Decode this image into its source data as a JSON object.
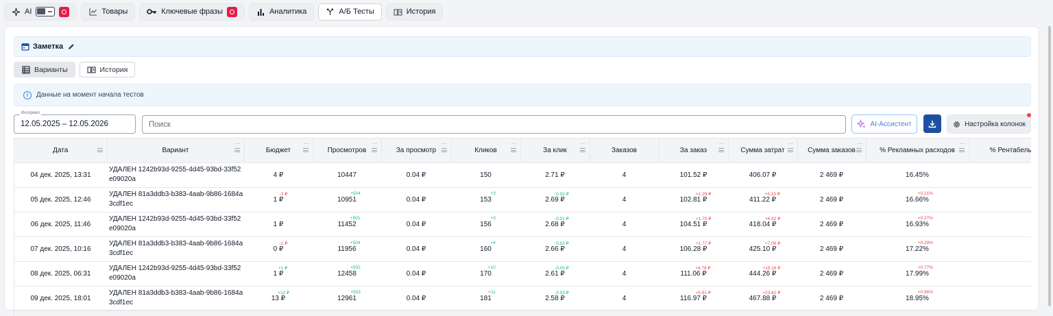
{
  "topbar": {
    "ai_label": "AI",
    "products_label": "Товары",
    "keywords_label": "Ключевые фразы",
    "analytics_label": "Аналитика",
    "abtests_label": "А/Б Тесты",
    "history_label": "История"
  },
  "note": {
    "title": "Заметка"
  },
  "subtabs": {
    "variants_label": "Варианты",
    "history_label": "История"
  },
  "info": {
    "text": "Данные на момент начала тестов"
  },
  "filters": {
    "interval_label": "Интервал",
    "interval_value": "12.05.2025 – 12.05.2026",
    "search_placeholder": "Поиск",
    "ai_button_label": "AI-Ассистент",
    "columns_button_label": "Настройка колонок"
  },
  "colors": {
    "accent": "#1e4fa3",
    "delta_up": "#10b981",
    "delta_down": "#ef4444",
    "badge": "#e11d48"
  },
  "table": {
    "headers": [
      "Дата",
      "Вариант",
      "Бюджет",
      "Просмотров",
      "За просмотр",
      "Кликов",
      "За клик",
      "Заказов",
      "За заказ",
      "Сумма затрат",
      "Сумма заказов",
      "% Рекламных расходов",
      "% Рентабельн"
    ],
    "rows": [
      {
        "date": "04 дек. 2025, 13:31",
        "variant": "УДАЛЕН 1242b93d-9255-4d45-93bd-33f52e09020a",
        "budget": "4 ₽",
        "budget_d": "",
        "budget_dc": "",
        "views": "10447",
        "views_d": "",
        "views_dc": "",
        "per_view": "0.04 ₽",
        "clicks": "150",
        "clicks_d": "",
        "clicks_dc": "",
        "per_click": "2.71 ₽",
        "per_click_d": "",
        "per_click_dc": "",
        "orders": "4",
        "per_order": "101.52 ₽",
        "per_order_d": "",
        "per_order_dc": "",
        "spend": "406.07 ₽",
        "spend_d": "",
        "spend_dc": "",
        "order_sum": "2 469 ₽",
        "ad_pct": "16.45%",
        "ad_pct_d": "",
        "ad_pct_dc": "",
        "profit": ""
      },
      {
        "date": "05 дек. 2025, 12:46",
        "variant": "УДАЛЕН 81a3ddb3-b383-4aab-9b86-1684a3cdf1ec",
        "budget": "1 ₽",
        "budget_d": "-3 ₽",
        "budget_dc": "down",
        "views": "10951",
        "views_d": "+504",
        "views_dc": "up",
        "per_view": "0.04 ₽",
        "clicks": "153",
        "clicks_d": "+3",
        "clicks_dc": "up",
        "per_click": "2.69 ₽",
        "per_click_d": "-0.02 ₽",
        "per_click_dc": "up",
        "orders": "4",
        "per_order": "102.81 ₽",
        "per_order_d": "+1.29 ₽",
        "per_order_dc": "down",
        "spend": "411.22 ₽",
        "spend_d": "+5.15 ₽",
        "spend_dc": "down",
        "order_sum": "2 469 ₽",
        "ad_pct": "16.66%",
        "ad_pct_d": "+0.21%",
        "ad_pct_dc": "down",
        "profit": ""
      },
      {
        "date": "06 дек. 2025, 11:46",
        "variant": "УДАЛЕН 1242b93d-9255-4d45-93bd-33f52e09020a",
        "budget": "1 ₽",
        "budget_d": "",
        "budget_dc": "",
        "views": "11452",
        "views_d": "+501",
        "views_dc": "up",
        "per_view": "0.04 ₽",
        "clicks": "156",
        "clicks_d": "+3",
        "clicks_dc": "up",
        "per_click": "2.68 ₽",
        "per_click_d": "-0.01 ₽",
        "per_click_dc": "up",
        "orders": "4",
        "per_order": "104.51 ₽",
        "per_order_d": "+1.70 ₽",
        "per_order_dc": "down",
        "spend": "418.04 ₽",
        "spend_d": "+6.82 ₽",
        "spend_dc": "down",
        "order_sum": "2 469 ₽",
        "ad_pct": "16.93%",
        "ad_pct_d": "+0.27%",
        "ad_pct_dc": "down",
        "profit": ""
      },
      {
        "date": "07 дек. 2025, 10:16",
        "variant": "УДАЛЕН 81a3ddb3-b383-4aab-9b86-1684a3cdf1ec",
        "budget": "0 ₽",
        "budget_d": "-1 ₽",
        "budget_dc": "down",
        "views": "11956",
        "views_d": "+504",
        "views_dc": "up",
        "per_view": "0.04 ₽",
        "clicks": "160",
        "clicks_d": "+4",
        "clicks_dc": "up",
        "per_click": "2.66 ₽",
        "per_click_d": "-0.02 ₽",
        "per_click_dc": "up",
        "orders": "4",
        "per_order": "106.28 ₽",
        "per_order_d": "+1.77 ₽",
        "per_order_dc": "down",
        "spend": "425.10 ₽",
        "spend_d": "+7.06 ₽",
        "spend_dc": "down",
        "order_sum": "2 469 ₽",
        "ad_pct": "17.22%",
        "ad_pct_d": "+0.29%",
        "ad_pct_dc": "down",
        "profit": ""
      },
      {
        "date": "08 дек. 2025, 06:31",
        "variant": "УДАЛЕН 1242b93d-9255-4d45-93bd-33f52e09020a",
        "budget": "1 ₽",
        "budget_d": "+1 ₽",
        "budget_dc": "up",
        "views": "12458",
        "views_d": "+502",
        "views_dc": "up",
        "per_view": "0.04 ₽",
        "clicks": "170",
        "clicks_d": "+10",
        "clicks_dc": "up",
        "per_click": "2.61 ₽",
        "per_click_d": "-0.05 ₽",
        "per_click_dc": "up",
        "orders": "4",
        "per_order": "111.06 ₽",
        "per_order_d": "+4.78 ₽",
        "per_order_dc": "down",
        "spend": "444.26 ₽",
        "spend_d": "+19.16 ₽",
        "spend_dc": "down",
        "order_sum": "2 469 ₽",
        "ad_pct": "17.99%",
        "ad_pct_d": "+0.77%",
        "ad_pct_dc": "down",
        "profit": ""
      },
      {
        "date": "09 дек. 2025, 18:01",
        "variant": "УДАЛЕН 81a3ddb3-b383-4aab-9b86-1684a3cdf1ec",
        "budget": "13 ₽",
        "budget_d": "+12 ₽",
        "budget_dc": "up",
        "views": "12961",
        "views_d": "+503",
        "views_dc": "up",
        "per_view": "0.04 ₽",
        "clicks": "181",
        "clicks_d": "+11",
        "clicks_dc": "up",
        "per_click": "2.58 ₽",
        "per_click_d": "-0.03 ₽",
        "per_click_dc": "up",
        "orders": "4",
        "per_order": "116.97 ₽",
        "per_order_d": "+5.91 ₽",
        "per_order_dc": "down",
        "spend": "467.88 ₽",
        "spend_d": "+23.62 ₽",
        "spend_dc": "down",
        "order_sum": "2 469 ₽",
        "ad_pct": "18.95%",
        "ad_pct_d": "+0.96%",
        "ad_pct_dc": "down",
        "profit": ""
      }
    ]
  }
}
